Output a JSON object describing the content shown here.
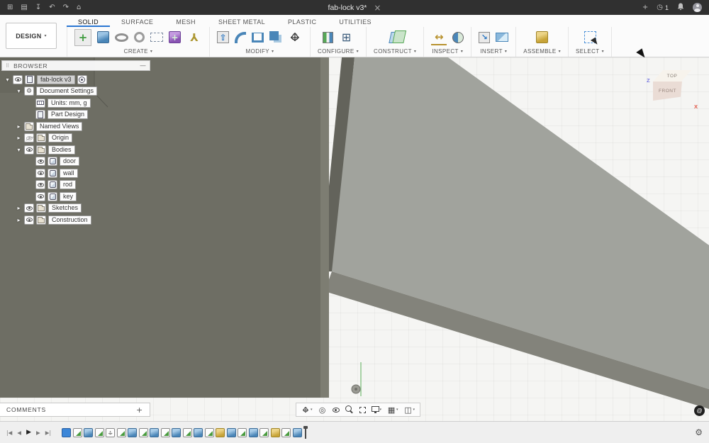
{
  "titlebar": {
    "left_icons": [
      {
        "name": "app-grid-icon",
        "glyph": "⊞"
      },
      {
        "name": "data-panel-icon",
        "glyph": "▤"
      },
      {
        "name": "save-icon",
        "glyph": "↧"
      },
      {
        "name": "undo-icon",
        "glyph": "↶"
      },
      {
        "name": "redo-icon",
        "glyph": "↷"
      },
      {
        "name": "home-icon",
        "glyph": "⌂"
      }
    ],
    "title": "fab-lock v3*",
    "close_glyph": "×",
    "new_tab_glyph": "+",
    "job_status": {
      "glyph": "◷",
      "count": "1"
    }
  },
  "toolbar": {
    "design_button": {
      "label": "DESIGN",
      "chevron": "▾"
    },
    "chevron": "▾",
    "tabs": [
      {
        "label": "SOLID",
        "active": true
      },
      {
        "label": "SURFACE",
        "active": false
      },
      {
        "label": "MESH",
        "active": false
      },
      {
        "label": "SHEET METAL",
        "active": false
      },
      {
        "label": "PLASTIC",
        "active": false
      },
      {
        "label": "UTILITIES",
        "active": false
      }
    ],
    "groups": [
      {
        "label": "CREATE",
        "icons": [
          {
            "name": "create-sketch-icon",
            "cls": "i-sketch",
            "glyph": "+"
          },
          {
            "name": "extrude-icon",
            "cls": "i-extrude"
          },
          {
            "name": "revolve-icon",
            "cls": "i-revolve"
          },
          {
            "name": "sweep-icon",
            "cls": "i-sweep"
          },
          {
            "name": "pattern-icon",
            "cls": "i-pattern"
          },
          {
            "name": "create-form-icon",
            "cls": "i-form",
            "glyph": "+"
          },
          {
            "name": "thread-icon",
            "cls": "i-thread",
            "glyph": "⅄"
          }
        ]
      },
      {
        "label": "MODIFY",
        "icons": [
          {
            "name": "press-pull-icon",
            "cls": "i-presspull",
            "glyph": "⇧"
          },
          {
            "name": "fillet-icon",
            "cls": "i-fillet"
          },
          {
            "name": "shell-icon",
            "cls": "i-shell"
          },
          {
            "name": "combine-icon",
            "cls": "i-combine"
          },
          {
            "name": "move-copy-icon",
            "cls": "i-move"
          }
        ]
      },
      {
        "label": "CONFIGURE",
        "icons": [
          {
            "name": "configure-icon",
            "cls": "i-configure"
          },
          {
            "name": "configuration-table-icon",
            "cls": "i-table",
            "glyph": "⊞"
          }
        ]
      },
      {
        "label": "CONSTRUCT",
        "icons": [
          {
            "name": "construction-plane-icon",
            "cls": "i-plane"
          }
        ]
      },
      {
        "label": "INSPECT",
        "icons": [
          {
            "name": "measure-icon",
            "cls": "i-measure",
            "glyph": "↔"
          },
          {
            "name": "section-analysis-icon",
            "cls": "i-section"
          }
        ]
      },
      {
        "label": "INSERT",
        "icons": [
          {
            "name": "insert-derive-icon",
            "cls": "i-insert",
            "glyph": "↘"
          },
          {
            "name": "insert-canvas-icon",
            "cls": "i-canvas"
          }
        ]
      },
      {
        "label": "ASSEMBLE",
        "icons": [
          {
            "name": "new-component-icon",
            "cls": "i-component"
          }
        ]
      },
      {
        "label": "SELECT",
        "icons": [
          {
            "name": "select-window-icon",
            "cls": "i-select"
          }
        ]
      }
    ]
  },
  "browser": {
    "header": {
      "title": "BROWSER",
      "grip": "⠿",
      "collapse_glyph": "—"
    },
    "items": [
      {
        "label": "fab-lock v3",
        "depth": 0,
        "arrow": "down",
        "eye": "on",
        "icon": "doc",
        "radio": true,
        "selected": true
      },
      {
        "label": "Document Settings",
        "depth": 1,
        "arrow": "down",
        "eye": null,
        "icon": "gear",
        "radio": false,
        "selected": false
      },
      {
        "label": "Units: mm, g",
        "depth": 2,
        "arrow": null,
        "eye": null,
        "icon": "units",
        "radio": false,
        "selected": false
      },
      {
        "label": "Part Design",
        "depth": 2,
        "arrow": null,
        "eye": null,
        "icon": "doc",
        "radio": false,
        "selected": false
      },
      {
        "label": "Named Views",
        "depth": 1,
        "arrow": "right",
        "eye": null,
        "icon": "folder",
        "radio": false,
        "selected": false
      },
      {
        "label": "Origin",
        "depth": 1,
        "arrow": "right",
        "eye": "off",
        "icon": "folder",
        "radio": false,
        "selected": false
      },
      {
        "label": "Bodies",
        "depth": 1,
        "arrow": "down",
        "eye": "on",
        "icon": "folder",
        "radio": false,
        "selected": false
      },
      {
        "label": "door",
        "depth": 2,
        "arrow": null,
        "eye": "on",
        "icon": "body",
        "radio": false,
        "selected": false
      },
      {
        "label": "wall",
        "depth": 2,
        "arrow": null,
        "eye": "on",
        "icon": "body",
        "radio": false,
        "selected": false
      },
      {
        "label": "rod",
        "depth": 2,
        "arrow": null,
        "eye": "on",
        "icon": "body",
        "radio": false,
        "selected": false
      },
      {
        "label": "key",
        "depth": 2,
        "arrow": null,
        "eye": "on",
        "icon": "body",
        "radio": false,
        "selected": false
      },
      {
        "label": "Sketches",
        "depth": 1,
        "arrow": "right",
        "eye": "on",
        "icon": "folder",
        "radio": false,
        "selected": false
      },
      {
        "label": "Construction",
        "depth": 1,
        "arrow": "right",
        "eye": "on",
        "icon": "folder",
        "radio": false,
        "selected": false
      }
    ]
  },
  "viewcube": {
    "top_label": "TOP",
    "front_label": "FRONT",
    "z_label": "Z",
    "x_label": "X"
  },
  "comments": {
    "label": "COMMENTS",
    "add_glyph": "+"
  },
  "assistant": {
    "glyph": "@"
  },
  "navbar": {
    "items": [
      {
        "name": "pan",
        "cls": "n-pan",
        "glyph": "",
        "dropdown": true
      },
      {
        "name": "orbit",
        "cls": "",
        "glyph": "◎",
        "dropdown": false
      },
      {
        "name": "look-at",
        "cls": "n-look",
        "glyph": "",
        "dropdown": false
      },
      {
        "name": "zoom",
        "cls": "n-zoom",
        "glyph": "",
        "dropdown": false
      },
      {
        "name": "fit",
        "cls": "n-fit",
        "glyph": "",
        "dropdown": false
      },
      {
        "name": "display-settings",
        "cls": "n-display",
        "glyph": "",
        "dropdown": true
      },
      {
        "name": "grid-and-snaps",
        "cls": "",
        "glyph": "▦",
        "dropdown": true
      },
      {
        "name": "viewports",
        "cls": "",
        "glyph": "◫",
        "dropdown": true
      }
    ]
  },
  "timeline": {
    "playback": [
      {
        "name": "go-to-start",
        "glyph": "|◀",
        "primary": false
      },
      {
        "name": "step-back",
        "glyph": "◀",
        "primary": false
      },
      {
        "name": "play",
        "glyph": "▶",
        "primary": true
      },
      {
        "name": "step-forward",
        "glyph": "▶",
        "primary": false
      },
      {
        "name": "go-to-end",
        "glyph": "▶|",
        "primary": false
      }
    ],
    "features": [
      {
        "type": "marker"
      },
      {
        "type": "sketch"
      },
      {
        "type": "extrude"
      },
      {
        "type": "sketch"
      },
      {
        "type": "move"
      },
      {
        "type": "sketch"
      },
      {
        "type": "extrude"
      },
      {
        "type": "sketch"
      },
      {
        "type": "extrude"
      },
      {
        "type": "sketch"
      },
      {
        "type": "extrude"
      },
      {
        "type": "sketch"
      },
      {
        "type": "extrude"
      },
      {
        "type": "sketch"
      },
      {
        "type": "gold"
      },
      {
        "type": "extrude"
      },
      {
        "type": "sketch"
      },
      {
        "type": "extrude"
      },
      {
        "type": "sketch"
      },
      {
        "type": "gold"
      },
      {
        "type": "sketch"
      },
      {
        "type": "extrude"
      }
    ],
    "settings_glyph": "⚙"
  },
  "colors": {
    "accent_blue": "#2a76d2",
    "titlebar_bg": "#303030",
    "canvas_bg": "#f5f5f3",
    "model_dark": "#6e6e64",
    "model_light": "#a1a39d",
    "axis_z": "#7a7ae0",
    "axis_x": "#e05545"
  }
}
